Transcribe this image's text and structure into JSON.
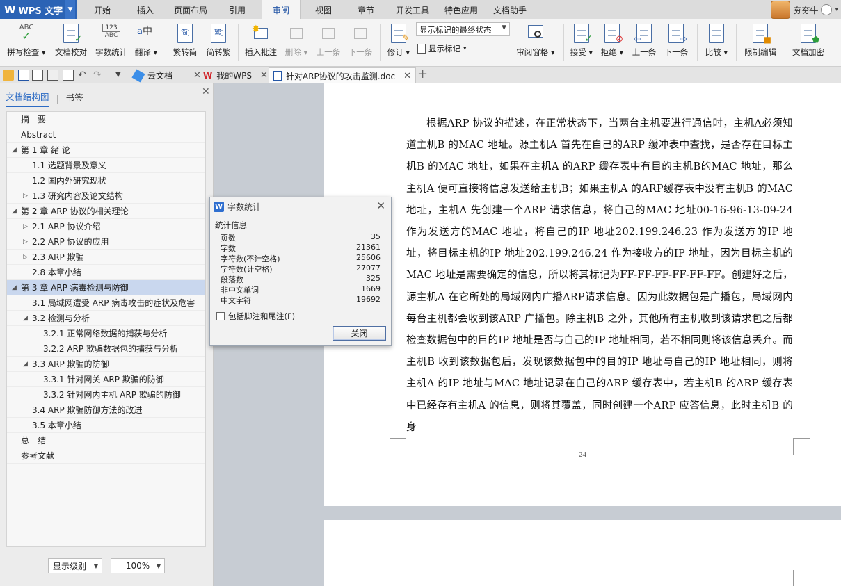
{
  "app": {
    "brand": "WPS 文字",
    "user": "夯夯牛"
  },
  "menu": {
    "tabs": [
      {
        "label": "开始"
      },
      {
        "label": "插入"
      },
      {
        "label": "页面布局"
      },
      {
        "label": "引用"
      },
      {
        "label": "审阅",
        "active": true
      },
      {
        "label": "视图"
      },
      {
        "label": "章节"
      },
      {
        "label": "开发工具"
      },
      {
        "label": "特色应用"
      },
      {
        "label": "文档助手"
      }
    ]
  },
  "ribbon": {
    "spellcheck": "拼写检查",
    "doc_proof": "文档校对",
    "word_count": "字数统计",
    "translate": "翻译",
    "to_traditional": "繁转简",
    "to_simplified": "简转繁",
    "insert_comment": "插入批注",
    "delete": "删除",
    "prev_comment": "上一条",
    "next_comment": "下一条",
    "revise": "修订",
    "show_markup_select": "显示标记的最终状态",
    "show_markup": "显示标记",
    "review_pane": "审阅窗格",
    "accept": "接受",
    "reject": "拒绝",
    "prev_change": "上一条",
    "next_change": "下一条",
    "compare": "比较",
    "restrict_edit": "限制编辑",
    "encrypt": "文档加密"
  },
  "doc_tabs": [
    {
      "label": "云文档"
    },
    {
      "label": "我的WPS"
    },
    {
      "label": "针对ARP协议的攻击监测.doc",
      "active": true
    }
  ],
  "nav": {
    "tab_outline": "文档结构图",
    "tab_bookmark": "书签",
    "items": [
      {
        "label": "摘　要",
        "level": 0,
        "toggle": ""
      },
      {
        "label": "Abstract",
        "level": 0,
        "toggle": ""
      },
      {
        "label": "第 1 章  绪  论",
        "level": 0,
        "toggle": "◢"
      },
      {
        "label": "1.1  选题背景及意义",
        "level": 1,
        "toggle": ""
      },
      {
        "label": "1.2  国内外研究现状",
        "level": 1,
        "toggle": ""
      },
      {
        "label": "1.3  研究内容及论文结构",
        "level": 1,
        "toggle": "▷"
      },
      {
        "label": "第 2 章  ARP 协议的相关理论",
        "level": 0,
        "toggle": "◢"
      },
      {
        "label": "2.1 ARP  协议介绍",
        "level": 1,
        "toggle": "▷"
      },
      {
        "label": "2.2 ARP  协议的应用",
        "level": 1,
        "toggle": "▷"
      },
      {
        "label": "2.3 ARP  欺骗",
        "level": 1,
        "toggle": "▷"
      },
      {
        "label": "2.8  本章小结",
        "level": 1,
        "toggle": ""
      },
      {
        "label": "第 3 章  ARP 病毒检测与防御",
        "level": 0,
        "toggle": "◢",
        "selected": true
      },
      {
        "label": "3.1  局域网遭受 ARP  病毒攻击的症状及危害",
        "level": 1,
        "toggle": ""
      },
      {
        "label": "3.2  检测与分析",
        "level": 1,
        "toggle": "◢"
      },
      {
        "label": "3.2.1  正常网络数据的捕获与分析",
        "level": 2,
        "toggle": ""
      },
      {
        "label": "3.2.2 ARP  欺骗数据包的捕获与分析",
        "level": 2,
        "toggle": ""
      },
      {
        "label": "3.3 ARP  欺骗的防御",
        "level": 1,
        "toggle": "◢"
      },
      {
        "label": "3.3.1  针对网关  ARP  欺骗的防御",
        "level": 2,
        "toggle": ""
      },
      {
        "label": "3.3.2  针对网内主机  ARP  欺骗的防御",
        "level": 2,
        "toggle": ""
      },
      {
        "label": "3.4 ARP  欺骗防御方法的改进",
        "level": 1,
        "toggle": ""
      },
      {
        "label": "3.5  本章小结",
        "level": 1,
        "toggle": ""
      },
      {
        "label": "总　结",
        "level": 0,
        "toggle": ""
      },
      {
        "label": "参考文献",
        "level": 0,
        "toggle": ""
      }
    ],
    "show_level": "显示级别",
    "zoom": "100%"
  },
  "document": {
    "paragraph": "根据ARP 协议的描述，在正常状态下，当两台主机要进行通信时，主机A必须知道主机B 的MAC 地址。源主机A 首先在自己的ARP 缓冲表中查找，是否存在目标主机B 的MAC 地址，如果在主机A 的ARP 缓存表中有目的主机B的MAC 地址，那么主机A 便可直接将信息发送给主机B；如果主机A 的ARP缓存表中没有主机B 的MAC 地址，主机A 先创建一个ARP 请求信息，将自己的MAC 地址00-16-96-13-09-24 作为发送方的MAC 地址，将自己的IP 地址202.199.246.23 作为发送方的IP 地址，将目标主机的IP 地址202.199.246.24 作为接收方的IP 地址，因为目标主机的MAC 地址是需要确定的信息，所以将其标记为FF-FF-FF-FF-FF-FF。创建好之后，源主机A 在它所处的局域网内广播ARP请求信息。因为此数据包是广播包，局域网内每台主机都会收到该ARP 广播包。除主机B 之外，其他所有主机收到该请求包之后都检查数据包中的目的IP 地址是否与自己的IP 地址相同，若不相同则将该信息丢弃。而主机B 收到该数据包后，发现该数据包中的目的IP 地址与自己的IP 地址相同，则将主机A 的IP 地址与MAC 地址记录在自己的ARP 缓存表中，若主机B 的ARP 缓存表中已经存有主机A 的信息，则将其覆盖，同时创建一个ARP 应答信息，此时主机B 的身",
    "page_number": "24"
  },
  "word_count_dialog": {
    "title": "字数统计",
    "section": "统计信息",
    "stats": [
      {
        "label": "页数",
        "value": "35"
      },
      {
        "label": "字数",
        "value": "21361"
      },
      {
        "label": "字符数(不计空格)",
        "value": "25606"
      },
      {
        "label": "字符数(计空格)",
        "value": "27077"
      },
      {
        "label": "段落数",
        "value": "325"
      },
      {
        "label": "非中文单词",
        "value": "1669"
      },
      {
        "label": "中文字符",
        "value": "19692"
      }
    ],
    "include_footnotes": "包括脚注和尾注(F)",
    "close_button": "关闭"
  },
  "colors": {
    "accent": "#2b63b5",
    "selected_row": "#c9d7ee",
    "page_bg": "#c7ccd3"
  }
}
